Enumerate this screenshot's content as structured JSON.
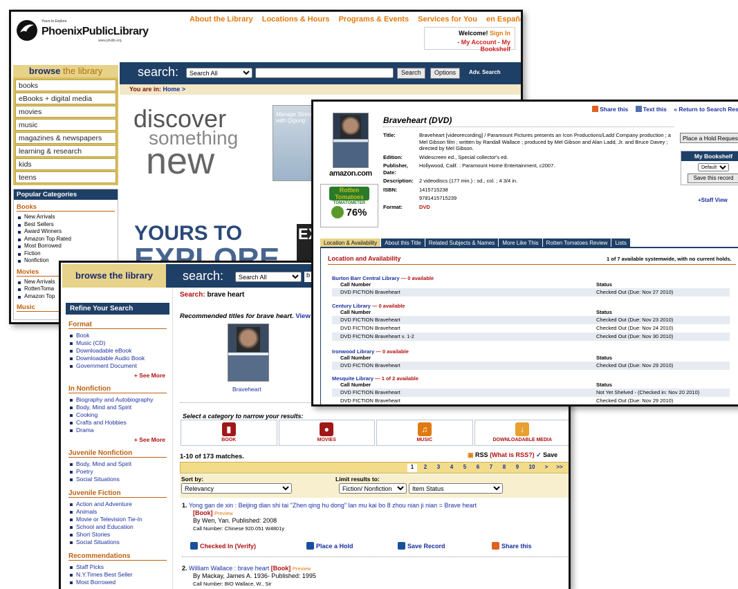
{
  "home": {
    "logo_small": "Yours to Explore",
    "logo_name": "PhoenixPublicLibrary",
    "logo_url": "www.phxlib.org",
    "topnav": [
      "About the Library",
      "Locations & Hours",
      "Programs & Events",
      "Services for You",
      "en Español"
    ],
    "welcome": "Welcome!",
    "sign_in": "Sign In",
    "my_account": "- My Account",
    "my_bookshelf": "- My Bookshelf",
    "browse_head_a": "browse",
    "browse_head_b": "the library",
    "browse_items": [
      "books",
      "eBooks + digital media",
      "movies",
      "music",
      "magazines & newspapers",
      "learning & research",
      "kids",
      "teens"
    ],
    "search_label": "search:",
    "search_scope": "Search All",
    "search_btn": "Search",
    "options_btn": "Options",
    "adv_search": "Adv. Search",
    "you_are_in": "You are in:",
    "home_crumb": "Home >",
    "discover": [
      "discover",
      "something",
      "new"
    ],
    "book_caption": "Manage Stress with Qigong",
    "yours": "YOURS TO",
    "explore": "EXPLORE",
    "ex": "EX",
    "popular_head": "Popular Categories",
    "books_sect": "Books",
    "books_items": [
      "New Arrivals",
      "Best Sellers",
      "Award Winners",
      "Amazon Top Rated",
      "Most Borrowed",
      "Fiction",
      "Nonfiction"
    ],
    "movies_sect": "Movies",
    "movies_items": [
      "New Arrivals",
      "RottenToma",
      "Amazon Top"
    ],
    "music_sect": "Music"
  },
  "results": {
    "browse_head": "browse the library",
    "search_label": "search:",
    "search_scope": "Search All",
    "search_stub": "b",
    "refine_head": "Refine Your Search",
    "format_sect": "Format",
    "format_items": [
      "Book",
      "Music (CD)",
      "Downloadable eBook",
      "Downloadable Audio Book",
      "Government Document"
    ],
    "see_more": "+ See More",
    "nonfiction_sect": "In Nonfiction",
    "nonfiction_items": [
      "Biography and Autobiography",
      "Body, Mind and Spirit",
      "Cooking",
      "Crafts and Hobbies",
      "Drama"
    ],
    "juv_nonfiction_sect": "Juvenile Nonfiction",
    "juv_nonfiction_items": [
      "Body, Mind and Spirit",
      "Poetry",
      "Social Situations"
    ],
    "juv_fiction_sect": "Juvenile Fiction",
    "juv_fiction_items": [
      "Action and Adventure",
      "Animals",
      "Movie or Television Tie-In",
      "School and Education",
      "Short Stories",
      "Social Situations"
    ],
    "recommend_sect": "Recommendations",
    "recommend_items": [
      "Staff Picks",
      "N.Y.Times Best Seller",
      "Most Borrowed"
    ],
    "search_prefix": "Search:",
    "query": "brave heart",
    "recommended": "Recommended titles for brave heart.",
    "view": "View",
    "cover_caption": "Braveheart",
    "cat_heading": "Select a category to narrow your results:",
    "categories": [
      "BOOK",
      "MOVIES",
      "MUSIC",
      "DOWNLOADABLE MEDIA"
    ],
    "matches": "1-10 of 173 matches.",
    "rss": "RSS",
    "what_rss": "(What is RSS?)",
    "save": "Save",
    "pages": [
      "1",
      "2",
      "3",
      "4",
      "5",
      "6",
      "7",
      "8",
      "9",
      "10",
      ">",
      ">>"
    ],
    "sort_by": "Sort by:",
    "sort_value": "Relevancy",
    "limit_to": "Limit results to:",
    "limit_value": "Fiction/ Nonfiction",
    "status_value": "Item Status",
    "r1_num": "1.",
    "r1_title": "Yong gan de xin : Beijing dian shi tai \"Zhen qing hu dong\" lan mu kai bo 8 zhou nian ji nian = Brave heart",
    "r1_type": "[Book]",
    "preview": "Preview",
    "r1_by": "By Wen, Yan.   Published: 2008",
    "r1_call": "Call Number: Chinese 920.051 W4801y",
    "act_checked": "Checked In (Verify)",
    "act_hold": "Place a Hold",
    "act_save": "Save Record",
    "act_share": "Share this",
    "r2_num": "2.",
    "r2_title": "William Wallace : brave heart",
    "r2_type": "[Book]",
    "r2_by": "By Mackay, James A. 1936-   Published: 1995",
    "r2_call": "Call Number: BIO Wallace, W., Sir"
  },
  "detail": {
    "share": "Share this",
    "text": "Text this",
    "return": "« Return to Search Resu",
    "amazon": "amazon.com",
    "rt_logo": "Rotten Tomatoes",
    "tomatometer": "TOMATOMETER",
    "rt_score": "76%",
    "title": "Braveheart (DVD)",
    "fields": [
      {
        "k": "Title:",
        "v": "Braveheart [videorecording] / Paramount Pictures presents an Icon Productions/Ladd Company production ; a Mel Gibson film ; written by Randall Wallace ; produced by Mel Gibson and Alan Ladd, Jr. and Bruce Davey ; directed by Mel Gibson."
      },
      {
        "k": "Edition:",
        "v": "Widescreen ed., Special collector's ed."
      },
      {
        "k": "Publisher, Date:",
        "v": "Hollywood, Calif. : Paramount Home Entertainment, c2007."
      },
      {
        "k": "Description:",
        "v": "2 videodiscs (177 min.) : sd., col. ; 4 3/4 in."
      },
      {
        "k": "ISBN:",
        "v": "1415715238"
      },
      {
        "k": "",
        "v": "9781415715239"
      },
      {
        "k": "Format:",
        "v": "DVD"
      }
    ],
    "hold_btn": "Place a Hold Request",
    "my_bookshelf": "My Bookshelf",
    "shelf_default": "Default",
    "save_record": "Save this record",
    "staff_view": "+Staff View",
    "tabs": [
      "Location & Availability",
      "About this Title",
      "Related Subjects & Names",
      "More Like This",
      "Rotten Tomatoes Review",
      "Lists"
    ],
    "avail_head": "Location and Availability",
    "avail_count": "1 of 7 available systemwide, with no current holds.",
    "call_hd": "Call Number",
    "status_hd": "Status",
    "libs": [
      {
        "name": "Burton Barr Central Library",
        "avail": "— 0 available",
        "rows": [
          [
            "DVD FICTION Braveheart",
            "Checked Out (Due: Nov 27 2010)"
          ]
        ]
      },
      {
        "name": "Century Library",
        "avail": "— 0 available",
        "rows": [
          [
            "DVD FICTION Braveheart",
            "Checked Out (Due: Nov 23 2010)"
          ],
          [
            "DVD FICTION Braveheart",
            "Checked Out (Due: Nov 24 2010)"
          ],
          [
            "DVD FICTION Braveheart v. 1-2",
            "Checked Out (Due: Nov 30 2010)"
          ]
        ]
      },
      {
        "name": "Ironwood Library",
        "avail": "— 0 available",
        "rows": [
          [
            "DVD FICTION Braveheart",
            "Checked Out (Due: Nov 29 2010)"
          ]
        ]
      },
      {
        "name": "Mesquite Library",
        "avail": "— 1 of 2 available",
        "rows": [
          [
            "DVD FICTION Braveheart",
            "Not Yet Shelved - (Checked in: Nov 20 2010)"
          ],
          [
            "DVD FICTION Braveheart",
            "Checked Out (Due: Nov 29 2010)"
          ]
        ]
      }
    ]
  }
}
